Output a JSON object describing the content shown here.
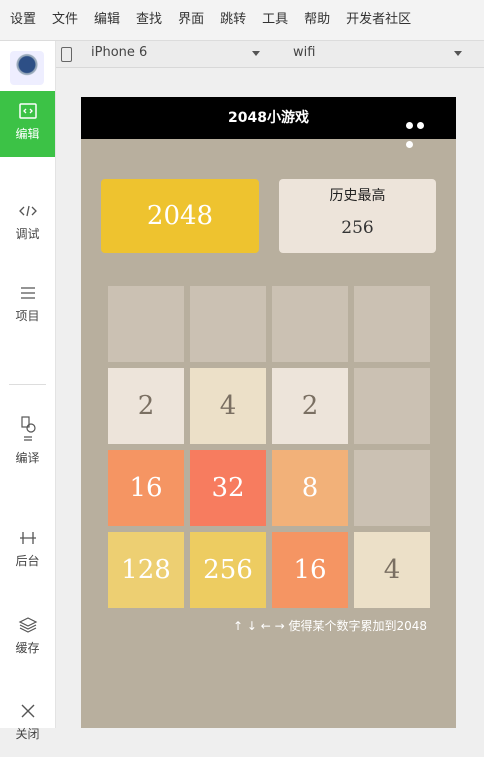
{
  "menu": [
    "设置",
    "文件",
    "编辑",
    "查找",
    "界面",
    "跳转",
    "工具",
    "帮助",
    "开发者社区"
  ],
  "sidebar": {
    "items": [
      {
        "label": "编辑",
        "icon": "code-editor-icon",
        "active": true
      },
      {
        "label": "调试",
        "icon": "debug-icon",
        "active": false
      },
      {
        "label": "项目",
        "icon": "project-icon",
        "active": false
      },
      {
        "label": "编译",
        "icon": "compile-icon",
        "active": false
      },
      {
        "label": "后台",
        "icon": "background-icon",
        "active": false
      },
      {
        "label": "缓存",
        "icon": "cache-icon",
        "active": false
      },
      {
        "label": "关闭",
        "icon": "close-icon",
        "active": false
      }
    ]
  },
  "device_bar": {
    "device": "iPhone 6",
    "network": "wifi"
  },
  "app": {
    "title": "2048小游戏",
    "score": "2048",
    "best_label": "历史最高",
    "best_value": "256",
    "hint": "↑ ↓ ← → 使得某个数字累加到2048",
    "board": [
      [
        "",
        "",
        "",
        ""
      ],
      [
        "2",
        "4",
        "2",
        ""
      ],
      [
        "16",
        "32",
        "8",
        ""
      ],
      [
        "128",
        "256",
        "16",
        "4"
      ]
    ]
  },
  "colors": {
    "accent": "#3cc246",
    "empty": "#cbc1b3",
    "2": "#ede4da",
    "4": "#ece0c8",
    "8": "#f2b179",
    "16": "#f59563",
    "32": "#f77c5f",
    "128": "#edcf72",
    "256": "#edcc61"
  }
}
